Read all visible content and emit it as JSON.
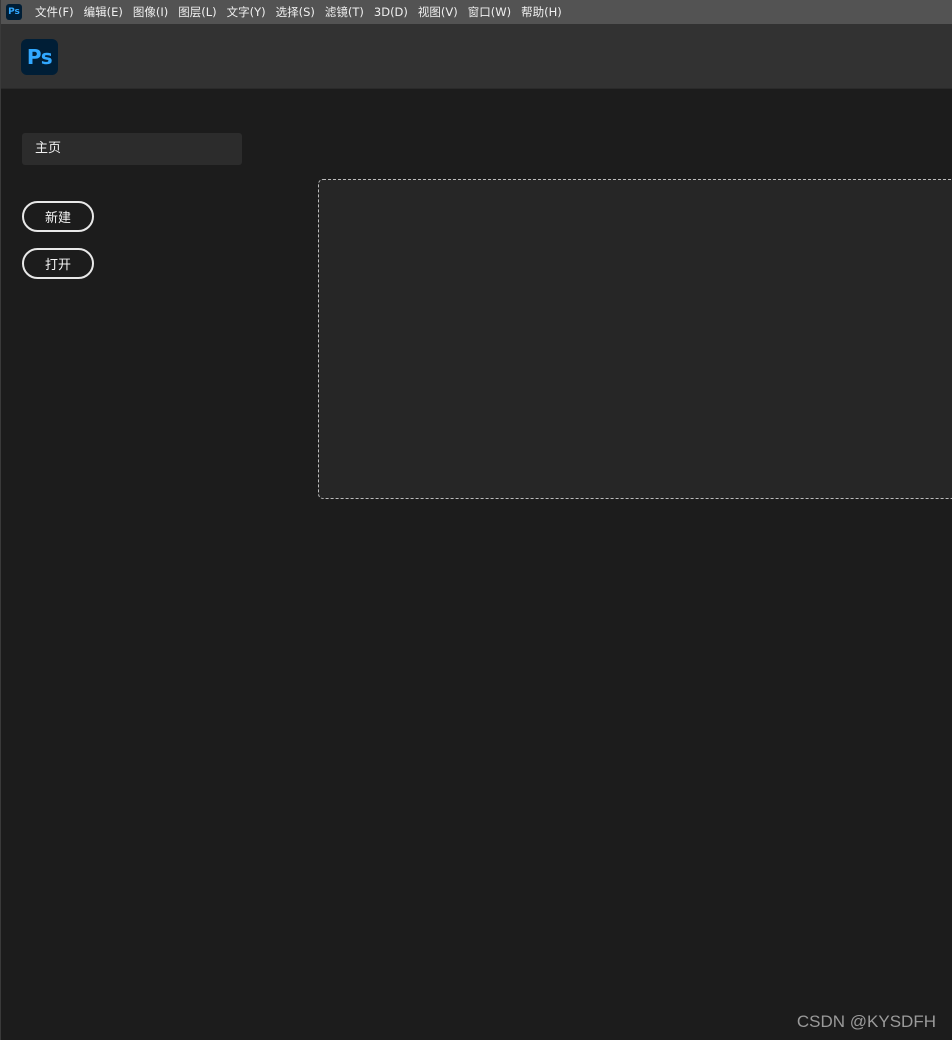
{
  "app": {
    "icon_label": "Ps",
    "logo_label": "Ps",
    "brand_color": "#31a8ff",
    "logo_bg": "#001e36"
  },
  "menubar": {
    "items": [
      {
        "label": "文件(F)"
      },
      {
        "label": "编辑(E)"
      },
      {
        "label": "图像(I)"
      },
      {
        "label": "图层(L)"
      },
      {
        "label": "文字(Y)"
      },
      {
        "label": "选择(S)"
      },
      {
        "label": "滤镜(T)"
      },
      {
        "label": "3D(D)"
      },
      {
        "label": "视图(V)"
      },
      {
        "label": "窗口(W)"
      },
      {
        "label": "帮助(H)"
      }
    ]
  },
  "sidebar": {
    "home_label": "主页",
    "new_label": "新建",
    "open_label": "打开"
  },
  "watermark": "CSDN @KYSDFH"
}
